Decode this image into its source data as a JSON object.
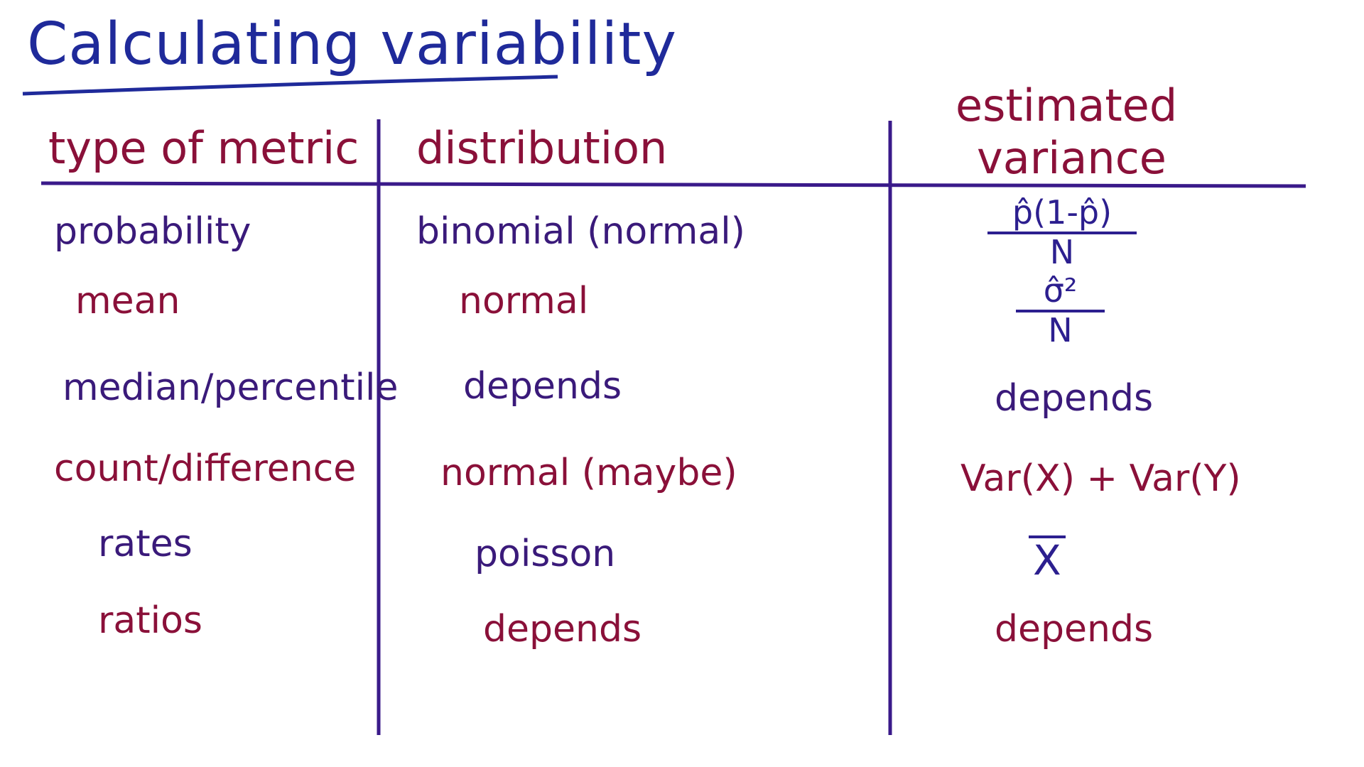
{
  "title": "Calculating variability",
  "headers": {
    "metric": "type of metric",
    "distribution": "distribution",
    "variance_line1": "estimated",
    "variance_line2": "variance"
  },
  "rows": [
    {
      "metric": "probability",
      "distribution": "binomial (normal)",
      "variance": {
        "numerator": "p̂(1-p̂)",
        "denominator": "N"
      }
    },
    {
      "metric": "mean",
      "distribution": "normal",
      "variance": {
        "numerator": "σ̂²",
        "denominator": "N"
      }
    },
    {
      "metric": "median/percentile",
      "distribution": "depends",
      "variance": {
        "text": "depends"
      }
    },
    {
      "metric": "count/difference",
      "distribution": "normal (maybe)",
      "variance": {
        "text": "Var(X) + Var(Y)"
      }
    },
    {
      "metric": "rates",
      "distribution": "poisson",
      "variance": {
        "text": "X"
      }
    },
    {
      "metric": "ratios",
      "distribution": "depends",
      "variance": {
        "text": "depends"
      }
    }
  ],
  "colors": {
    "title": "#1f2a9a",
    "rules": "#3a1a8a",
    "blue_ink": "#2c1f8f",
    "purple_ink": "#3a1a7a",
    "maroon_ink": "#8a1039"
  }
}
